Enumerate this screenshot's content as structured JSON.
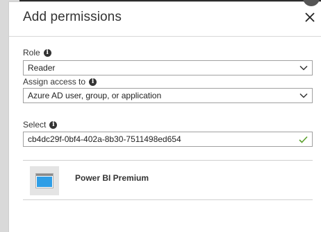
{
  "blade": {
    "title": "Add permissions"
  },
  "role": {
    "label": "Role",
    "value": "Reader"
  },
  "assign_access": {
    "label": "Assign access to",
    "value": "Azure AD user, group, or application"
  },
  "select": {
    "label": "Select",
    "value": "cb4dc29f-0bf4-402a-8b30-7511498ed654"
  },
  "results": [
    {
      "name": "Power BI Premium",
      "icon": "application-window-icon"
    }
  ],
  "colors": {
    "accent_check": "#5aa02c",
    "tile_blue": "#2f9ee6"
  }
}
